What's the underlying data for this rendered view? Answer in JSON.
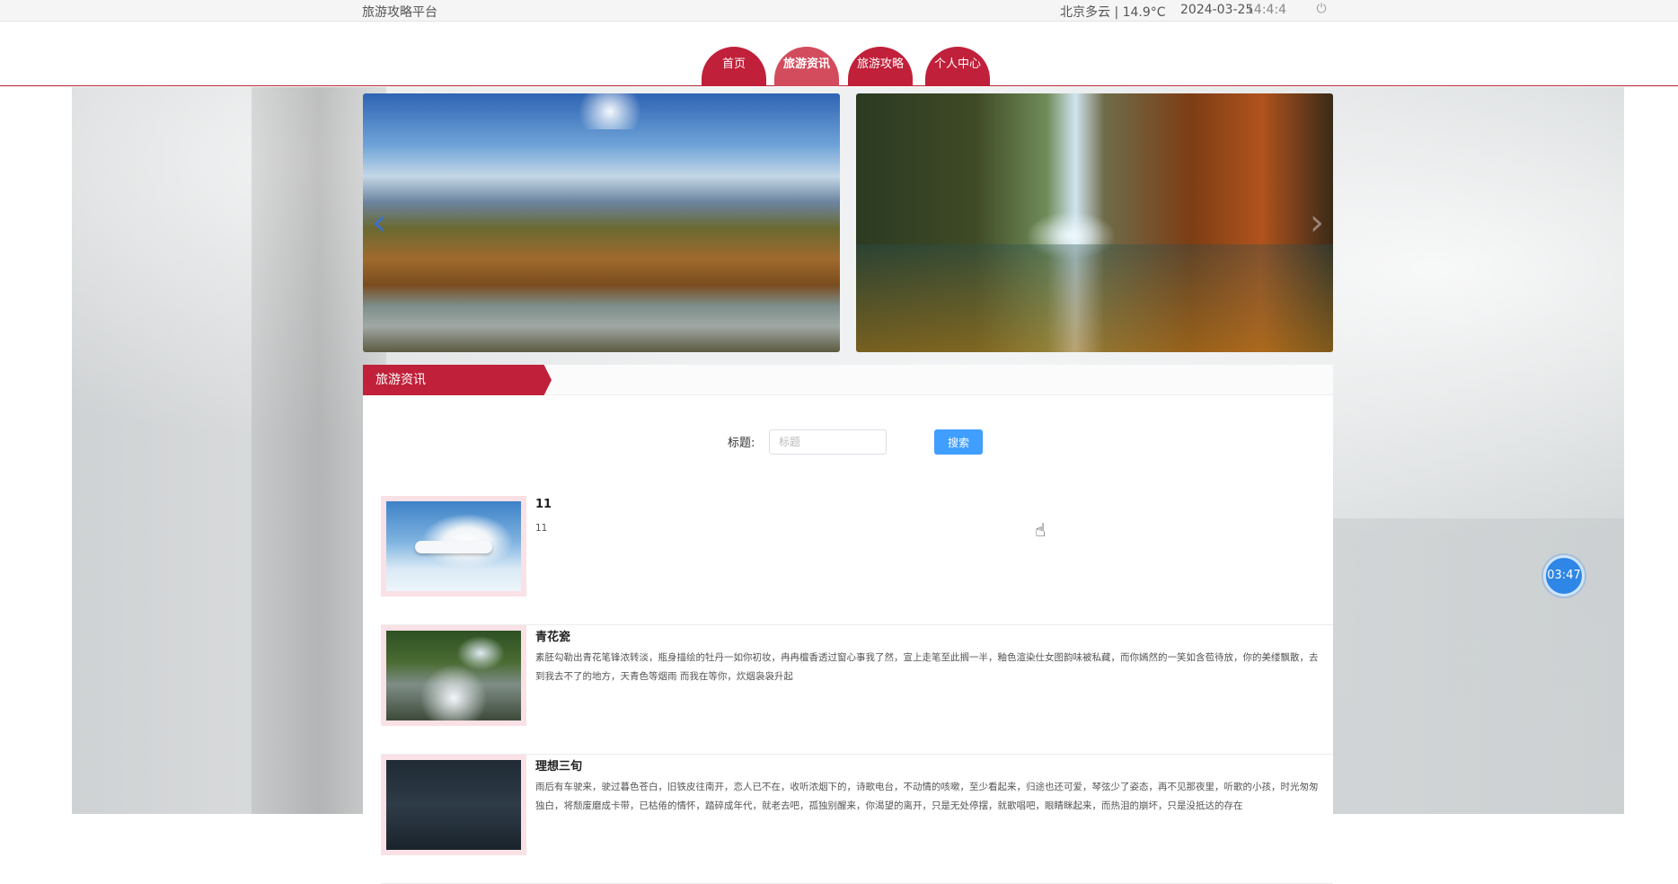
{
  "topbar": {
    "site_name": "旅游攻略平台",
    "weather": "北京多云 | 14.9°C",
    "date": "2024-03-25",
    "time": "14:4:4",
    "power_icon": "power-icon"
  },
  "nav": {
    "tabs": [
      {
        "label": "首页"
      },
      {
        "label": "旅游资讯"
      },
      {
        "label": "旅游攻略"
      },
      {
        "label": "个人中心"
      }
    ],
    "active": "旅游资讯",
    "accent": "#c0203a"
  },
  "carousel": {
    "prev_icon": "chevron-left-icon",
    "next_icon": "chevron-right-icon"
  },
  "section": {
    "title": "旅游资讯"
  },
  "search": {
    "label": "标题:",
    "placeholder": "标题",
    "value": "",
    "button": "搜索",
    "button_color": "#409eff"
  },
  "news": [
    {
      "title": "11",
      "desc": "11",
      "thumb": "airplane-photo"
    },
    {
      "title": "青花瓷",
      "desc": "素胚勾勒出青花笔锋浓转淡，瓶身描绘的牡丹一如你初妆，冉冉檀香透过窗心事我了然，宣上走笔至此搁一半，釉色渲染仕女图韵味被私藏，而你嫣然的一笑如含苞待放，你的美缕飘散，去到我去不了的地方，天青色等烟雨 而我在等你，炊烟袅袅升起",
      "thumb": "waterfall-photo"
    },
    {
      "title": "理想三旬",
      "desc": "雨后有车驶来，驶过暮色苍白，旧铁皮往南开，恋人已不在，收听浓烟下的，诗歌电台，不动情的咳嗽，至少看起来，归途也还可爱，琴弦少了姿态，再不见那夜里，听歌的小孩，时光匆匆独白，将颓废磨成卡带，已枯倦的情怀，踏碎成年代，就老去吧，孤独别醒来，你渴望的离开，只是无处停摆，就歌唱吧，眼睛眯起来，而热泪的崩坏，只是没抵达的存在",
      "thumb": "night-sky-photo"
    }
  ],
  "timer": {
    "value": "03:47"
  }
}
